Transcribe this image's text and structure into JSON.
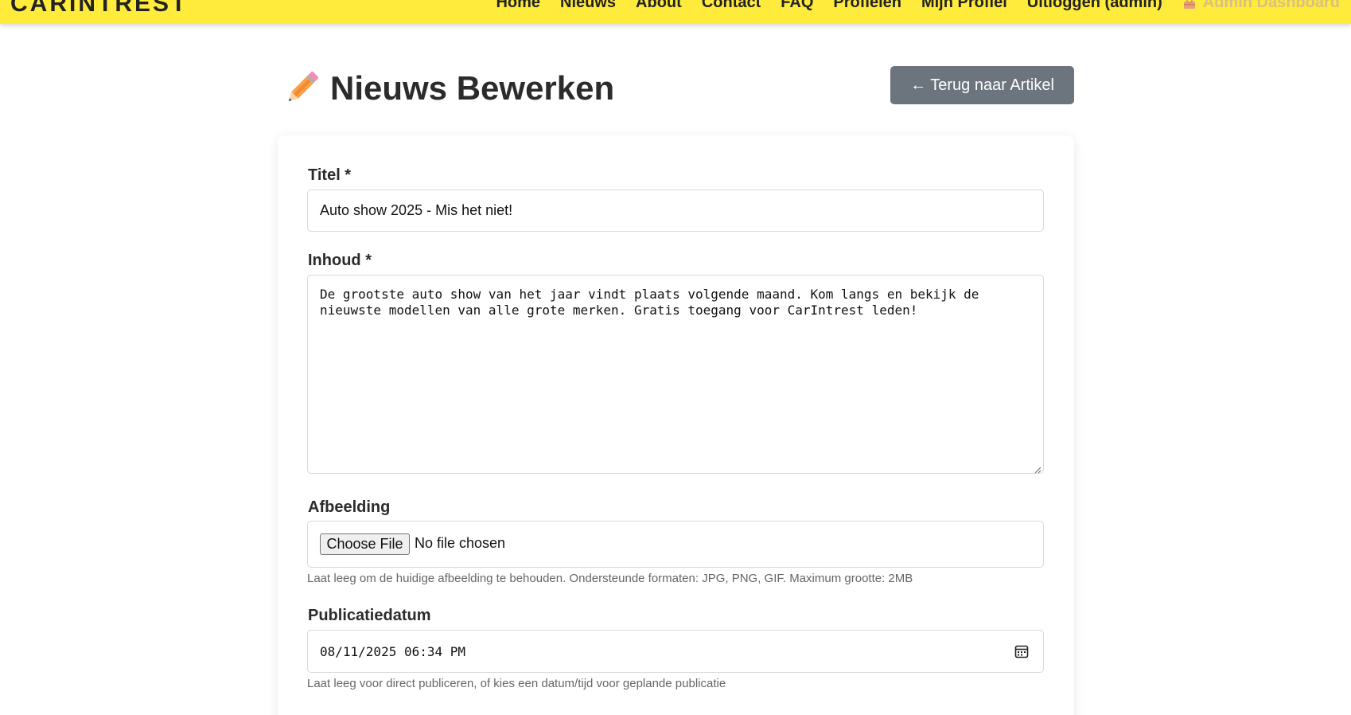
{
  "nav": {
    "logo": "CARINTREST",
    "links": [
      "Home",
      "Nieuws",
      "About",
      "Contact",
      "FAQ",
      "Profielen",
      "Mijn Profiel",
      "Uitloggen (admin)"
    ],
    "admin_link": "Admin Dashboard",
    "admin_icon": "toolbox-icon"
  },
  "header": {
    "title": "Nieuws Bewerken",
    "title_icon": "pencil-icon",
    "back_button": "← Terug naar Artikel"
  },
  "form": {
    "title_label": "Titel *",
    "title_value": "Auto show 2025 - Mis het niet!",
    "content_label": "Inhoud *",
    "content_value": "De grootste auto show van het jaar vindt plaats volgende maand. Kom langs en bekijk de nieuwste modellen van alle grote merken. Gratis toegang voor CarIntrest leden!",
    "image_label": "Afbeelding",
    "file_button": "Choose File",
    "file_status": "No file chosen",
    "image_help": "Laat leeg om de huidige afbeelding te behouden. Ondersteunde formaten: JPG, PNG, GIF. Maximum grootte: 2MB",
    "date_label": "Publicatiedatum",
    "date_value": "08/11/2025 06:34 PM",
    "date_help": "Laat leeg voor direct publiceren, of kies een datum/tijd voor geplande publicatie"
  },
  "colors": {
    "navbar": "#ffeb3b",
    "back_button": "#6c757d",
    "admin_link": "#d9c080"
  }
}
